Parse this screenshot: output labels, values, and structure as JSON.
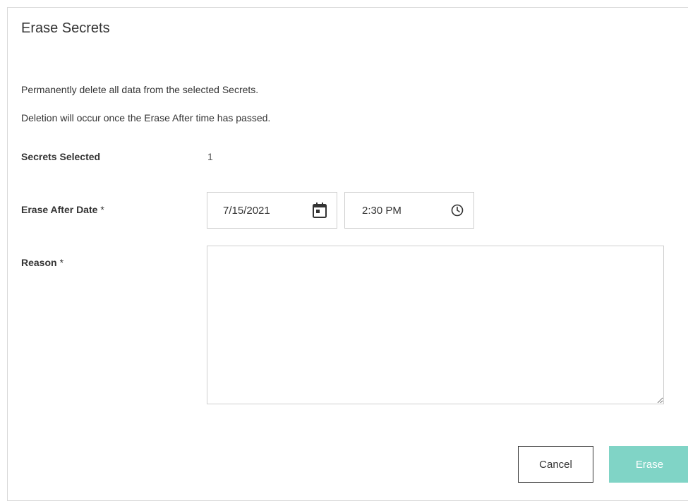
{
  "dialog": {
    "title": "Erase Secrets",
    "description_line1": "Permanently delete all data from the selected Secrets.",
    "description_line2": "Deletion will occur once the Erase After time has passed."
  },
  "form": {
    "secrets_selected_label": "Secrets Selected",
    "secrets_selected_value": "1",
    "erase_after_label": "Erase After Date",
    "required_marker": "*",
    "date_value": "7/15/2021",
    "date_icon": "calendar-icon",
    "time_value": "2:30 PM",
    "time_icon": "clock-icon",
    "reason_label": "Reason",
    "reason_value": ""
  },
  "buttons": {
    "cancel_label": "Cancel",
    "erase_label": "Erase"
  },
  "colors": {
    "erase_button_bg": "#80d4c6",
    "border": "#cfcfcf",
    "text": "#333333"
  }
}
